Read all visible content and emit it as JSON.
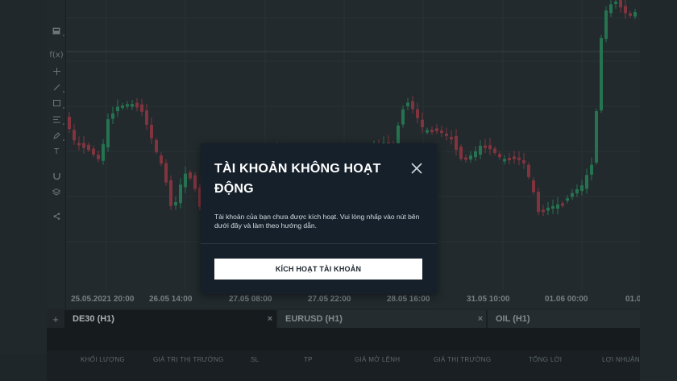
{
  "toolbar": {
    "tools": [
      {
        "icon": "rectangle-select-icon"
      },
      {
        "icon": "function-icon",
        "label": "f(x)"
      },
      {
        "icon": "crosshair-icon"
      },
      {
        "icon": "trend-line-icon"
      },
      {
        "icon": "rectangle-shape-icon"
      },
      {
        "icon": "fibonacci-icon"
      },
      {
        "icon": "pencil-icon"
      },
      {
        "icon": "text-icon",
        "label": "T"
      },
      {
        "icon": "magnet-icon"
      },
      {
        "icon": "layers-icon"
      },
      {
        "icon": "share-icon"
      }
    ]
  },
  "chart": {
    "x_labels": [
      "25.05.2021 20:00",
      "26.05 14:00",
      "27.05 08:00",
      "27.05 22:00",
      "28.05 16:00",
      "31.05 10:00",
      "01.06 00:00",
      "01.0"
    ],
    "colors": {
      "background": "#2a3337",
      "up": "#2e9466",
      "down": "#a8414e",
      "grid": "#323c41"
    }
  },
  "tabs": [
    {
      "label": "DE30 (H1)",
      "active": true
    },
    {
      "label": "EURUSD (H1)",
      "active": false
    },
    {
      "label": "OIL (H1)",
      "active": false
    }
  ],
  "tab_close_glyph": "×",
  "tab_add_glyph": "+",
  "positions": {
    "columns": [
      "KHỐI LƯỢNG",
      "GIÁ TRỊ THỊ TRƯỜNG",
      "SL",
      "TP",
      "GIÁ MỞ LỆNH",
      "GIÁ THỊ TRƯỜNG",
      "TỔNG LỜI",
      "LỢI NHUẬN"
    ]
  },
  "modal": {
    "title": "TÀI KHOẢN KHÔNG HOẠT ĐỘNG",
    "body": "Tài khoản của bạn chưa được kích hoạt. Vui lòng nhấp vào nút bên dưới đây và làm theo hướng dẫn.",
    "button_label": "KÍCH HOẠT TÀI KHOẢN",
    "close_icon": "close-icon"
  }
}
